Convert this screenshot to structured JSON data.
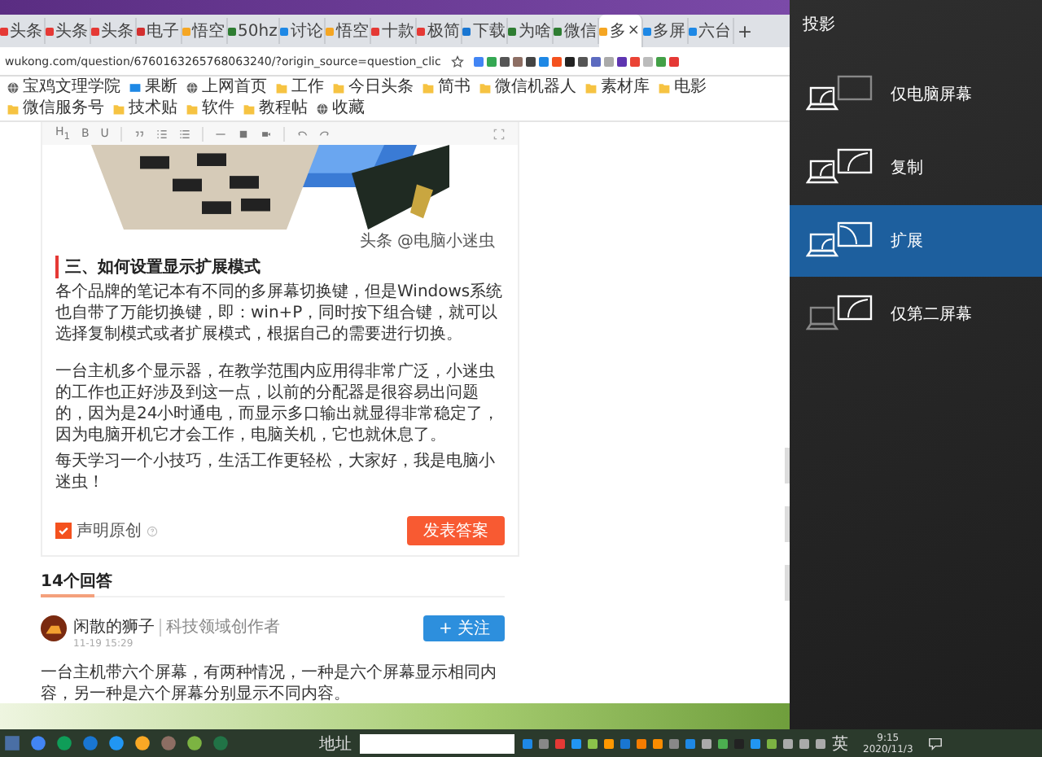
{
  "browser": {
    "tabs": [
      {
        "label": "头条",
        "color": "#e53935",
        "selected": false
      },
      {
        "label": "头条",
        "color": "#e53935",
        "selected": false
      },
      {
        "label": "头条",
        "color": "#e53935",
        "selected": false
      },
      {
        "label": "电子",
        "color": "#d32f2f",
        "selected": false
      },
      {
        "label": "悟空",
        "color": "#f5a623",
        "selected": false
      },
      {
        "label": "50hz",
        "color": "#2e7d32",
        "selected": false
      },
      {
        "label": "讨论",
        "color": "#1e88e5",
        "selected": false
      },
      {
        "label": "悟空",
        "color": "#f5a623",
        "selected": false
      },
      {
        "label": "十款",
        "color": "#e53935",
        "selected": false
      },
      {
        "label": "极简",
        "color": "#e53935",
        "selected": false
      },
      {
        "label": "下载",
        "color": "#1976d2",
        "selected": false
      },
      {
        "label": "为啥",
        "color": "#2e7d32",
        "selected": false
      },
      {
        "label": "微信",
        "color": "#2e7d32",
        "selected": false
      },
      {
        "label": "多",
        "color": "#f5a623",
        "selected": true
      },
      {
        "label": "多屏",
        "color": "#1e88e5",
        "selected": false
      },
      {
        "label": "六台",
        "color": "#1e88e5",
        "selected": false
      }
    ],
    "new_tab": "+",
    "close": "×",
    "address": "wukong.com/question/6760163265768063240/?origin_source=question_clic",
    "bookmarks": [
      {
        "label": "宝鸡文理学院",
        "kind": "globe"
      },
      {
        "label": "果断",
        "kind": "app"
      },
      {
        "label": "上网首页",
        "kind": "globe"
      },
      {
        "label": "工作",
        "kind": "folder"
      },
      {
        "label": "今日头条",
        "kind": "folder"
      },
      {
        "label": "简书",
        "kind": "folder"
      },
      {
        "label": "微信机器人",
        "kind": "folder"
      },
      {
        "label": "素材库",
        "kind": "folder"
      },
      {
        "label": "电影",
        "kind": "folder"
      },
      {
        "label": "微信服务号",
        "kind": "folder"
      },
      {
        "label": "技术贴",
        "kind": "folder"
      },
      {
        "label": "软件",
        "kind": "folder"
      },
      {
        "label": "教程帖",
        "kind": "folder"
      },
      {
        "label": "收藏",
        "kind": "globe"
      }
    ]
  },
  "editor": {
    "toolbar": [
      "H$_{1}$",
      "B",
      "U"
    ],
    "caption": "头条 @电脑小迷虫",
    "heading": "三、如何设置显示扩展模式",
    "paragraphs": [
      "各个品牌的笔记本有不同的多屏幕切换键，但是Windows系统也自带了万能切换键，即：win+P，同时按下组合键，就可以选择复制模式或者扩展模式，根据自己的需要进行切换。",
      "一台主机多个显示器，在教学范围内应用得非常广泛，小迷虫的工作也正好涉及到这一点，以前的分配器是很容易出问题的，因为是24小时通电，而显示多口输出就显得非常稳定了，因为电脑开机它才会工作，电脑关机，它也就休息了。",
      "每天学习一个小技巧，生活工作更轻松，大家好，我是电脑小迷虫！"
    ],
    "original": {
      "label": "声明原创",
      "checked": true
    },
    "submit": "发表答案"
  },
  "answers": {
    "count": "14个回答",
    "author": "闲散的狮子",
    "author_title": "科技领域创作者",
    "time": "11-19 15:29",
    "follow": "+ 关注",
    "text": "一台主机带六个屏幕，有两种情况，一种是六个屏幕显示相同内容，另一种是六个屏幕分别显示不同内容。"
  },
  "projection": {
    "title": "投影",
    "options": [
      {
        "label": "仅电脑屏幕",
        "kind": "pc_only",
        "selected": false
      },
      {
        "label": "复制",
        "kind": "duplicate",
        "selected": false
      },
      {
        "label": "扩展",
        "kind": "extend",
        "selected": true
      },
      {
        "label": "仅第二屏幕",
        "kind": "second_only",
        "selected": false
      }
    ]
  },
  "taskbar": {
    "address_label": "地址",
    "ime": "英",
    "time": "9:15",
    "date": "2020/11/3"
  }
}
